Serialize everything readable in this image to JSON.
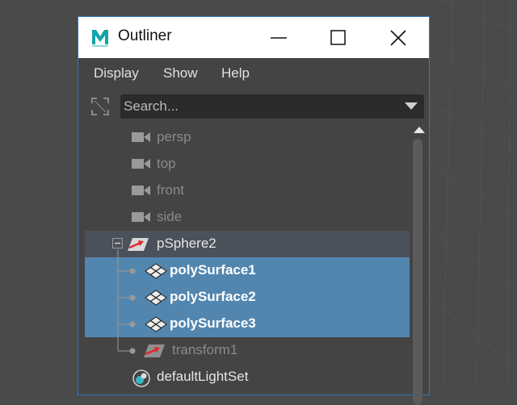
{
  "window": {
    "title": "Outliner",
    "app_icon": "maya-logo",
    "buttons": [
      "minimize-icon",
      "maximize-icon",
      "close-icon"
    ]
  },
  "menubar": {
    "items": [
      "Display",
      "Show",
      "Help"
    ]
  },
  "search": {
    "placeholder": "Search...",
    "filter_icon": "filter-icon",
    "dropdown_icon": "chevron-down-icon"
  },
  "tree": {
    "rows": [
      {
        "label": "persp",
        "icon": "camera-icon",
        "style": "dim"
      },
      {
        "label": "top",
        "icon": "camera-icon",
        "style": "dim"
      },
      {
        "label": "front",
        "icon": "camera-icon",
        "style": "dim"
      },
      {
        "label": "side",
        "icon": "camera-icon",
        "style": "dim"
      },
      {
        "label": "pSphere2",
        "icon": "transform-icon",
        "style": "bright",
        "expanded": true
      },
      {
        "label": "polySurface1",
        "icon": "mesh-icon",
        "style": "selected"
      },
      {
        "label": "polySurface2",
        "icon": "mesh-icon",
        "style": "selected"
      },
      {
        "label": "polySurface3",
        "icon": "mesh-icon",
        "style": "selected"
      },
      {
        "label": "transform1",
        "icon": "transform-icon",
        "style": "dim"
      },
      {
        "label": "defaultLightSet",
        "icon": "set-icon",
        "style": "bright"
      }
    ]
  },
  "colors": {
    "selection": "#5286af",
    "hover": "#4b515a",
    "window_border": "#2b79c2",
    "transform_arrow": "#e0272e"
  }
}
